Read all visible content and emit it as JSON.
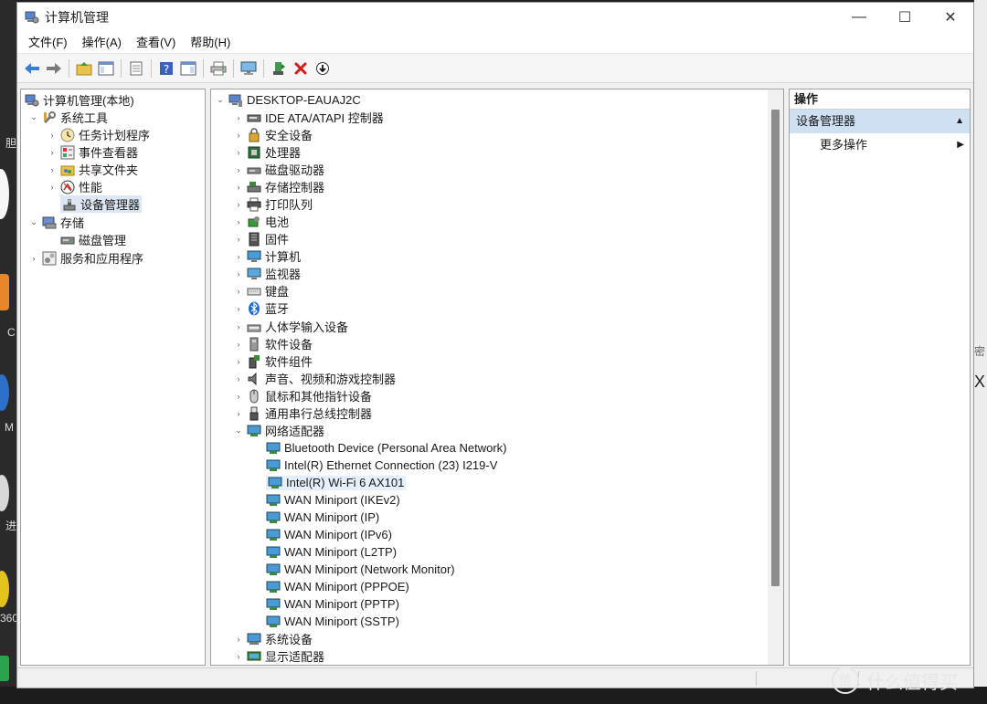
{
  "window": {
    "title": "计算机管理",
    "minimize_symbol": "—",
    "maximize_symbol": "☐",
    "close_symbol": "✕"
  },
  "menu": [
    "文件(F)",
    "操作(A)",
    "查看(V)",
    "帮助(H)"
  ],
  "toolbar": {
    "icons": [
      "back-arrow-icon",
      "forward-arrow-icon",
      "up-folder-icon",
      "show-hide-tree-icon",
      "properties-icon",
      "help-icon",
      "show-hide-action-pane-icon",
      "print-icon",
      "monitor-icon",
      "update-driver-icon",
      "uninstall-icon",
      "scan-hardware-icon"
    ]
  },
  "left_tree": {
    "root": "计算机管理(本地)",
    "groups": [
      {
        "label": "系统工具",
        "expanded": true,
        "children": [
          "任务计划程序",
          "事件查看器",
          "共享文件夹",
          "性能",
          "设备管理器"
        ]
      },
      {
        "label": "存储",
        "expanded": true,
        "children": [
          "磁盘管理"
        ]
      },
      {
        "label": "服务和应用程序",
        "expanded": false,
        "children": []
      }
    ],
    "selected": "设备管理器"
  },
  "device_tree": {
    "root": "DESKTOP-EAUAJ2C",
    "categories": [
      "IDE ATA/ATAPI 控制器",
      "安全设备",
      "处理器",
      "磁盘驱动器",
      "存储控制器",
      "打印队列",
      "电池",
      "固件",
      "计算机",
      "监视器",
      "键盘",
      "蓝牙",
      "人体学输入设备",
      "软件设备",
      "软件组件",
      "声音、视频和游戏控制器",
      "鼠标和其他指针设备",
      "通用串行总线控制器",
      "网络适配器"
    ],
    "network_adapters": [
      "Bluetooth Device (Personal Area Network)",
      "Intel(R) Ethernet Connection (23) I219-V",
      "Intel(R) Wi-Fi 6 AX101",
      "WAN Miniport (IKEv2)",
      "WAN Miniport (IP)",
      "WAN Miniport (IPv6)",
      "WAN Miniport (L2TP)",
      "WAN Miniport (Network Monitor)",
      "WAN Miniport (PPPOE)",
      "WAN Miniport (PPTP)",
      "WAN Miniport (SSTP)"
    ],
    "selected_adapter": "Intel(R) Wi-Fi 6 AX101",
    "after_categories": [
      "系统设备",
      "显示适配器"
    ]
  },
  "actions": {
    "title": "操作",
    "section": "设备管理器",
    "more": "更多操作"
  },
  "watermark": {
    "text": "什么值得买",
    "icon_label": "值"
  },
  "desktop_fragments": [
    "胆",
    "C",
    "M",
    "进",
    "360",
    "密",
    "X"
  ]
}
